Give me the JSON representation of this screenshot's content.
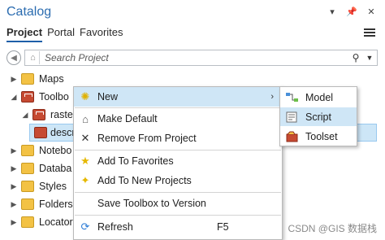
{
  "pane": {
    "title": "Catalog"
  },
  "tabs": [
    {
      "label": "Project",
      "active": true
    },
    {
      "label": "Portal",
      "active": false
    },
    {
      "label": "Favorites",
      "active": false
    }
  ],
  "search": {
    "placeholder": "Search Project"
  },
  "tree": {
    "items": [
      {
        "label": "Maps",
        "icon": "maps-folder-icon",
        "expanded": false
      },
      {
        "label": "Toolbo",
        "icon": "toolboxes-folder-icon",
        "expanded": true
      },
      {
        "label": "raste",
        "icon": "toolbox-icon",
        "expanded": false
      },
      {
        "label": "descr",
        "icon": "script-tool-icon",
        "selected": true
      },
      {
        "label": "Notebo",
        "icon": "notebooks-folder-icon",
        "expanded": false
      },
      {
        "label": "Databa",
        "icon": "databases-folder-icon",
        "expanded": false
      },
      {
        "label": "Styles",
        "icon": "styles-folder-icon",
        "expanded": false
      },
      {
        "label": "Folders",
        "icon": "folders-folder-icon",
        "expanded": false
      },
      {
        "label": "Locators",
        "icon": "locators-folder-icon",
        "expanded": false
      }
    ]
  },
  "context_menu": {
    "items": [
      {
        "label": "New",
        "icon": "new-sparkle-icon",
        "has_submenu": true,
        "highlighted": true
      },
      {
        "label": "Make Default",
        "icon": "home-icon"
      },
      {
        "label": "Remove From Project",
        "icon": "close-x-icon"
      },
      {
        "label": "Add To Favorites",
        "icon": "star-icon"
      },
      {
        "label": "Add To New Projects",
        "icon": "star-add-icon"
      },
      {
        "label": "Save Toolbox to Version",
        "icon": ""
      },
      {
        "label": "Refresh",
        "icon": "refresh-icon",
        "shortcut": "F5"
      }
    ]
  },
  "submenu": {
    "items": [
      {
        "label": "Model",
        "icon": "model-icon"
      },
      {
        "label": "Script",
        "icon": "script-icon",
        "highlighted": true
      },
      {
        "label": "Toolset",
        "icon": "toolset-icon"
      }
    ]
  },
  "watermark": "CSDN @GIS 数据栈",
  "colors": {
    "accent": "#2b6cb0",
    "highlight": "#cfe6f6",
    "toolbox": "#c64a32",
    "folder": "#f3c244"
  }
}
